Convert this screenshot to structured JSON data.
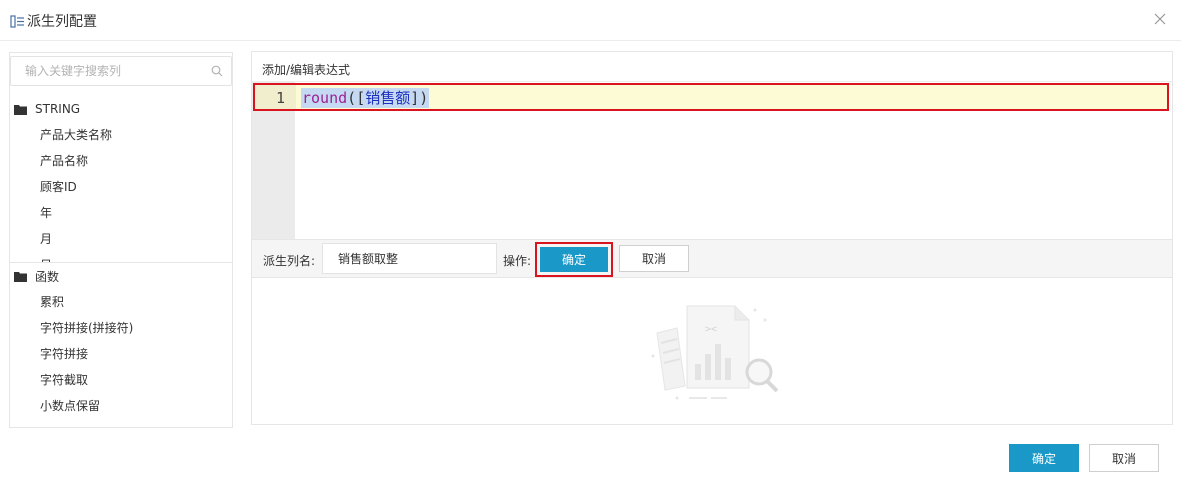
{
  "dialog": {
    "title": "派生列配置"
  },
  "left": {
    "search_placeholder": "输入关键字搜索列",
    "groups": [
      {
        "name": "STRING",
        "items": [
          "产品大类名称",
          "产品名称",
          "顾客ID",
          "年",
          "月",
          "日"
        ]
      },
      {
        "name": "函数",
        "items": [
          "累积",
          "字符拼接(拼接符)",
          "字符拼接",
          "字符截取",
          "小数点保留"
        ]
      }
    ]
  },
  "editor": {
    "label": "添加/编辑表达式",
    "line_number": "1",
    "code": {
      "fn": "round",
      "open": "(",
      "lbr": "[",
      "field": "销售额",
      "rbr": "]",
      "close": ")"
    }
  },
  "form": {
    "name_label": "派生列名:",
    "name_value": "销售额取整",
    "op_label": "操作:",
    "ok_label": "确定",
    "cancel_label": "取消"
  },
  "footer": {
    "ok_label": "确定",
    "cancel_label": "取消"
  },
  "colors": {
    "primary": "#1a99c9",
    "highlight_border": "#d9141e"
  }
}
